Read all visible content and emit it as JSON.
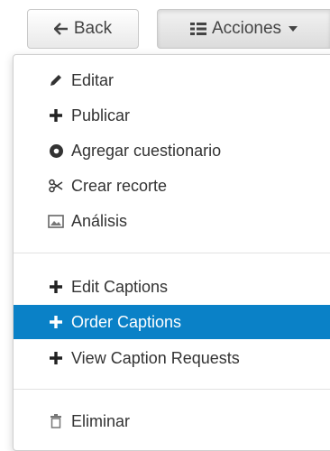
{
  "toolbar": {
    "back_label": "Back",
    "acciones_label": "Acciones"
  },
  "menu": {
    "items": [
      {
        "label": "Editar",
        "icon": "pencil-icon"
      },
      {
        "label": "Publicar",
        "icon": "plus-icon"
      },
      {
        "label": "Agregar cuestionario",
        "icon": "cog-icon"
      },
      {
        "label": "Crear recorte",
        "icon": "scissors-icon"
      },
      {
        "label": "Análisis",
        "icon": "image-icon"
      },
      {
        "label": "Edit Captions",
        "icon": "plus-icon"
      },
      {
        "label": "Order Captions",
        "icon": "plus-icon",
        "active": true
      },
      {
        "label": "View Caption Requests",
        "icon": "plus-icon"
      },
      {
        "label": "Eliminar",
        "icon": "trash-icon"
      }
    ]
  },
  "colors": {
    "highlight": "#0a81c7"
  }
}
